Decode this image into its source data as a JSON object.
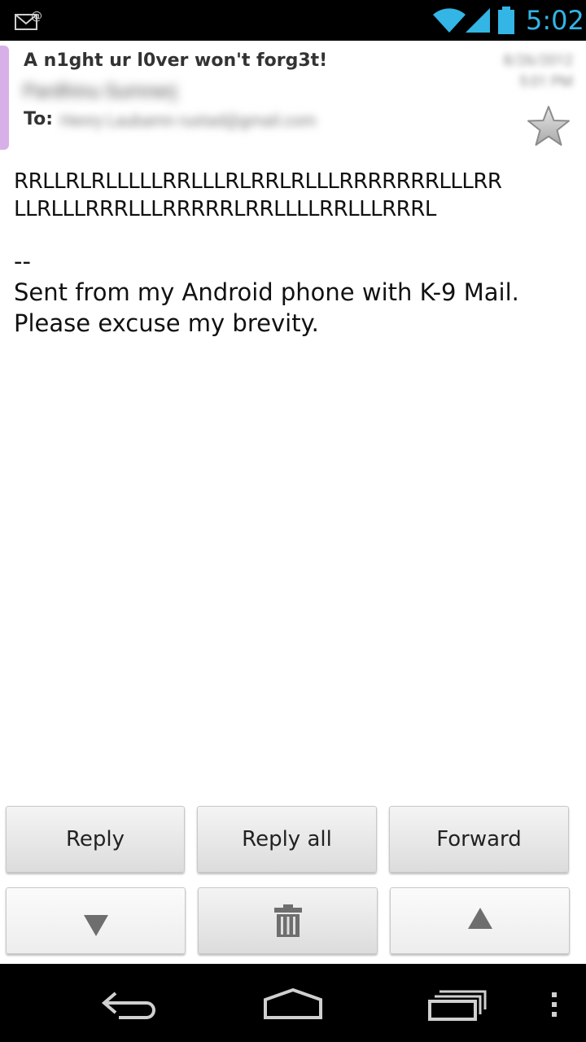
{
  "status_bar": {
    "time": "5:02",
    "icons": [
      "email-notification-icon",
      "wifi-icon",
      "signal-icon",
      "battery-icon"
    ]
  },
  "message": {
    "subject": "A n1ght ur l0ver won't forg3t!",
    "from": "Pardhinu Sumnerj",
    "to_label": "To:",
    "to": "Henry Laubamn rustad@gmail.com",
    "date": "8/26/2012",
    "time": "5:01 PM",
    "starred": false,
    "body_lines": [
      "RRLLRLRLLLLLRRLLLRLRRLRLLLRRRRRRRLLLRR",
      "LLRLLLRRRLLLRRRRRLRRLLLLRRLLLRRRL"
    ],
    "signature_sep": "--",
    "signature_lines": [
      "Sent from my Android phone with K-9 Mail.",
      "Please excuse my brevity."
    ]
  },
  "actions": {
    "reply": "Reply",
    "reply_all": "Reply all",
    "forward": "Forward",
    "previous": "down-triangle-icon",
    "delete": "trash-icon",
    "next": "up-triangle-icon"
  },
  "nav_bar": {
    "back": "back-icon",
    "home": "home-icon",
    "recents": "recents-icon",
    "menu": "overflow-menu-icon"
  },
  "colors": {
    "accent": "#33b5e5",
    "account_chip": "#d8b0e8"
  }
}
